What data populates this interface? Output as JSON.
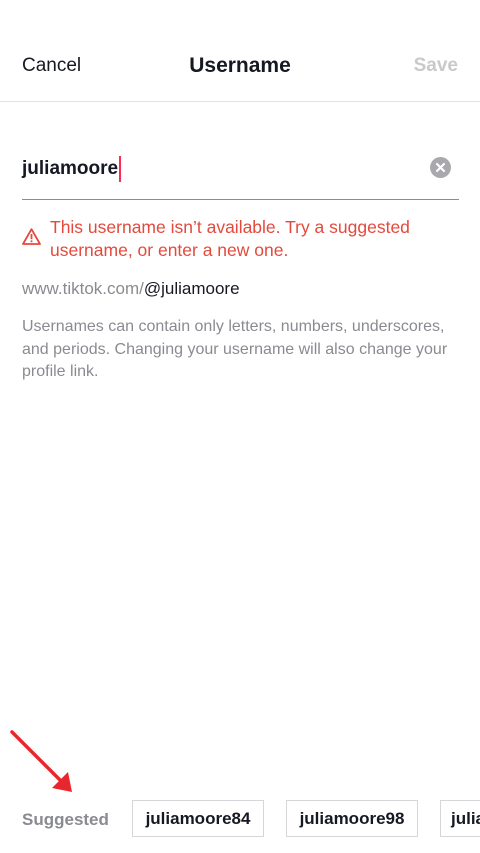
{
  "header": {
    "cancel_label": "Cancel",
    "title": "Username",
    "save_label": "Save"
  },
  "username_input": {
    "value": "juliamoore"
  },
  "error": {
    "message": "This username isn’t available. Try a suggested username, or enter a new one."
  },
  "profile_link": {
    "prefix": "www.tiktok.com/",
    "handle": "@juliamoore"
  },
  "help_text": "Usernames can contain only letters, numbers, underscores, and periods. Changing your username will also change your profile link.",
  "suggested": {
    "label": "Suggested",
    "items": [
      "juliamoore84",
      "juliamoore98",
      "julia"
    ]
  },
  "colors": {
    "error": "#e34a3d",
    "caret": "#fe2c55",
    "save_disabled": "#c9c9cc",
    "annotation_arrow": "#e8262d"
  },
  "icons": {
    "clear": "clear-circle-icon",
    "error": "warning-triangle-icon"
  }
}
